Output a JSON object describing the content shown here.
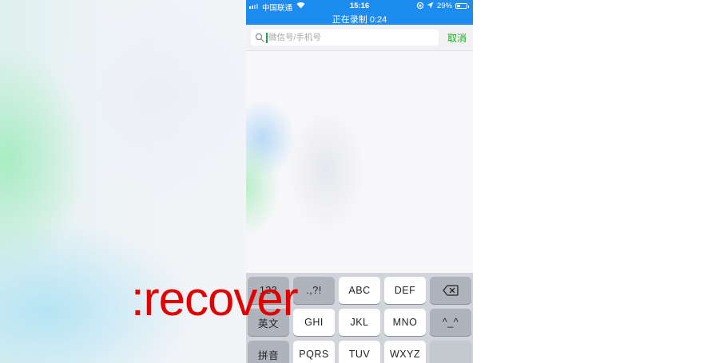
{
  "status_bar": {
    "carrier": "中国联通",
    "time": "15:16",
    "battery": "29%",
    "recording": "正在录制 0:24"
  },
  "search": {
    "placeholder": "微信号/手机号",
    "value": "",
    "cancel_label": "取消"
  },
  "keyboard": {
    "row1": [
      "123",
      ".,?!",
      "ABC",
      "DEF"
    ],
    "row2": [
      "英文",
      "GHI",
      "JKL",
      "MNO",
      "^_^"
    ],
    "row3": [
      "拼音",
      "PQRS",
      "TUV",
      "WXYZ"
    ]
  },
  "watermark": ":recover",
  "colors": {
    "status_bar": "#1c8cf0",
    "cancel": "#1aad19",
    "watermark": "#e20000"
  }
}
